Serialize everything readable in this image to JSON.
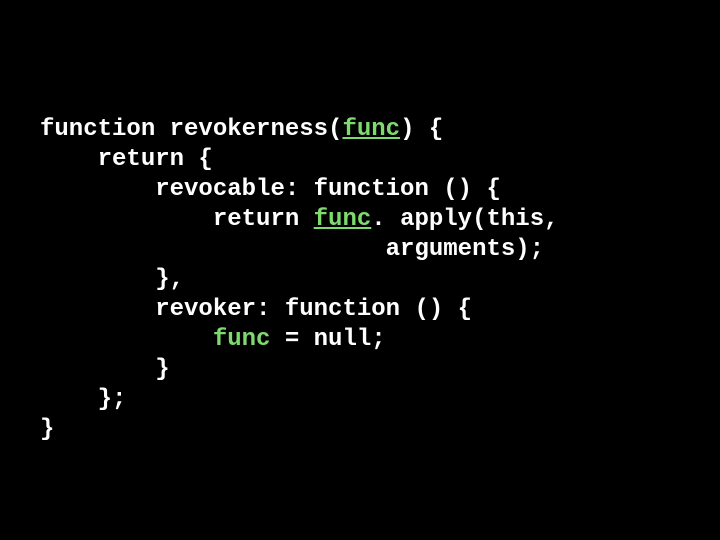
{
  "code": {
    "line1": {
      "a": "function revokerness(",
      "b": "func",
      "c": ") {"
    },
    "line2": "    return {",
    "line3": "        revocable: function () {",
    "line4": {
      "a": "            return ",
      "b": "func",
      "c": ". apply(this, "
    },
    "line5": "                        arguments);",
    "line6": "        },",
    "line7": "        revoker: function () {",
    "line8": {
      "a": "            ",
      "b": "func",
      "c": " = null;"
    },
    "line9": "        }",
    "line10": "    };",
    "line11": "}"
  }
}
